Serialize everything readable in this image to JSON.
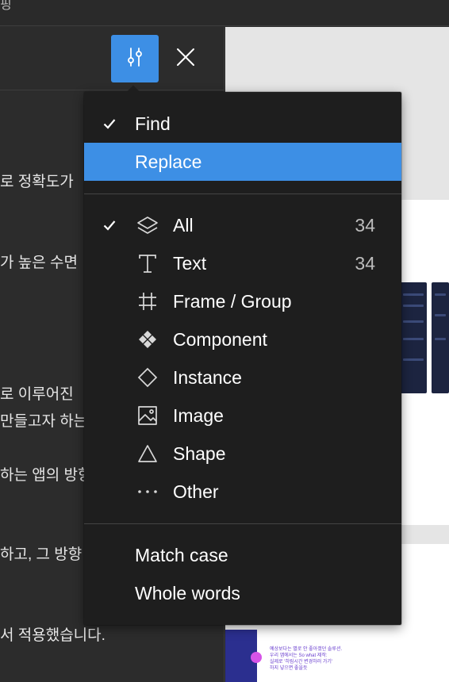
{
  "top_fragment": "핑",
  "left_panel_lines": [
    "로 정확도가 ",
    "가 높은 수면 ",
    "로 이루어진 ",
    "만들고자 하는",
    "하는 앱의 방향",
    "하고, 그 방향",
    "서 적용했습니다."
  ],
  "menu": {
    "mode_items": [
      {
        "label": "Find",
        "checked": true,
        "selected": false
      },
      {
        "label": "Replace",
        "checked": false,
        "selected": true
      }
    ],
    "filter_items": [
      {
        "label": "All",
        "icon": "layers-icon",
        "count": "34",
        "checked": true
      },
      {
        "label": "Text",
        "icon": "text-icon",
        "count": "34",
        "checked": false
      },
      {
        "label": "Frame / Group",
        "icon": "frame-icon",
        "count": "",
        "checked": false
      },
      {
        "label": "Component",
        "icon": "component-icon",
        "count": "",
        "checked": false
      },
      {
        "label": "Instance",
        "icon": "instance-icon",
        "count": "",
        "checked": false
      },
      {
        "label": "Image",
        "icon": "image-icon",
        "count": "",
        "checked": false
      },
      {
        "label": "Shape",
        "icon": "shape-icon",
        "count": "",
        "checked": false
      },
      {
        "label": "Other",
        "icon": "more-icon",
        "count": "",
        "checked": false
      }
    ],
    "option_items": [
      {
        "label": "Match case"
      },
      {
        "label": "Whole words"
      }
    ]
  },
  "canvas_note": "예상보다는 별로 안 좋아졌던 솔루션.\n우리 앱에서는 So what 제작:\n실제로 '히림시간 변경하러 가기'\n하지 넣으면 좋을듯",
  "colors": {
    "accent": "#3d8fe5",
    "menu_bg": "#1e1e1e",
    "panel_bg": "#2c2c2c"
  }
}
